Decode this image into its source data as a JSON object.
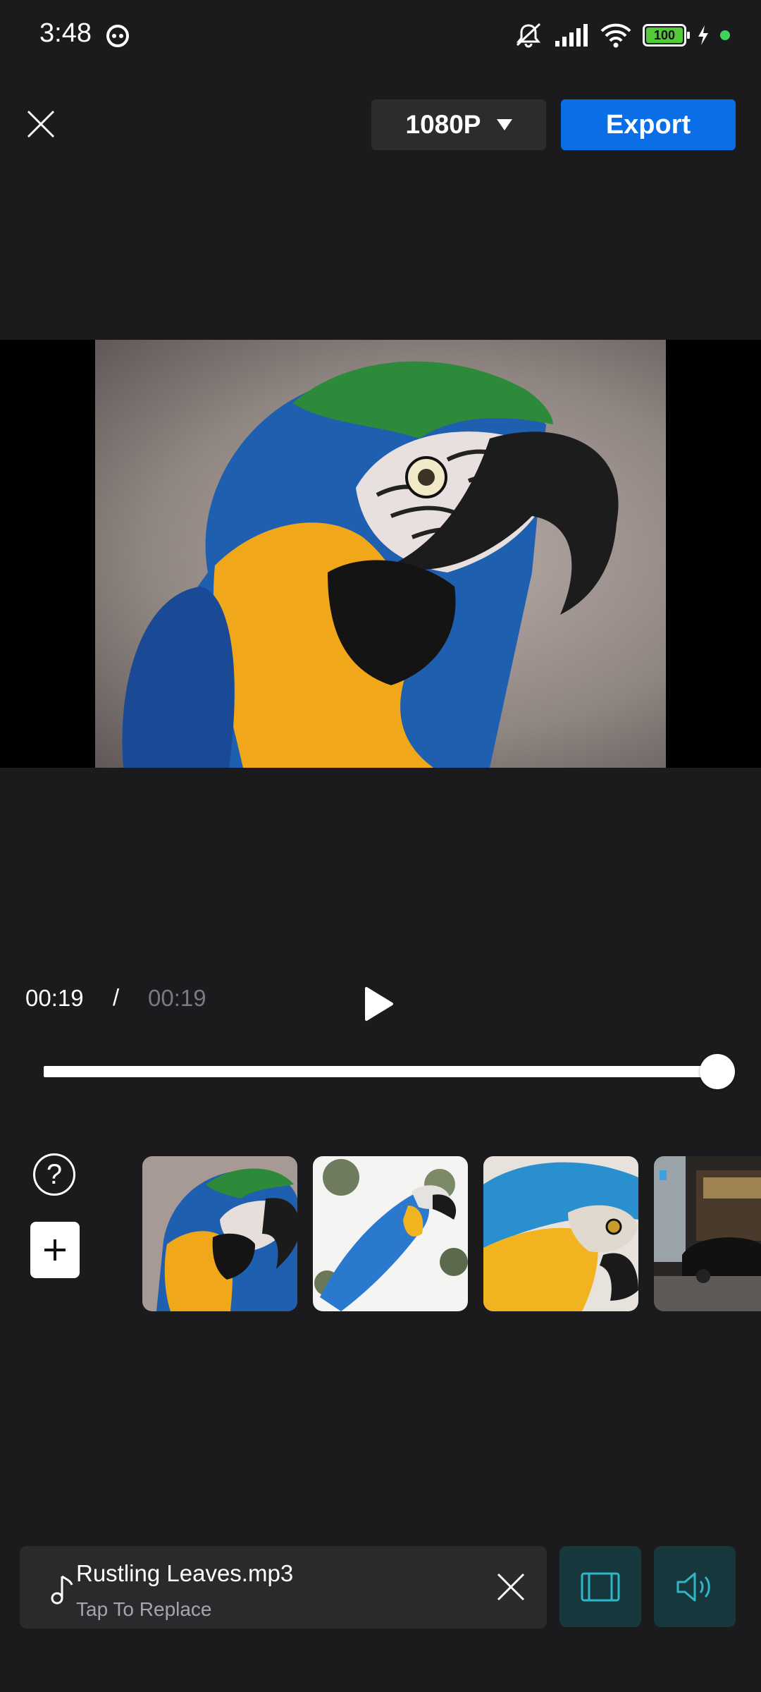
{
  "status_bar": {
    "time": "3:48",
    "battery": "100",
    "icons": [
      "assistant-face-icon",
      "mute-icon",
      "signal-icon",
      "wifi-icon",
      "battery-icon",
      "charging-icon"
    ]
  },
  "toolbar": {
    "resolution_label": "1080P",
    "export_label": "Export"
  },
  "player": {
    "current_time": "00:19",
    "separator": "/",
    "total_time": "00:19",
    "progress_percent": 100
  },
  "timeline": {
    "help_label": "?",
    "clips": [
      {
        "name": "clip-macaw-closeup"
      },
      {
        "name": "clip-macaw-branch"
      },
      {
        "name": "clip-macaw-profile"
      },
      {
        "name": "clip-car-street"
      }
    ]
  },
  "music": {
    "title": "Rustling Leaves.mp3",
    "subtitle": "Tap To Replace"
  },
  "colors": {
    "background": "#1b1b1d",
    "accent": "#0a6ee6",
    "tool_button_bg": "#16373c",
    "tool_icon": "#2fb7c9"
  }
}
